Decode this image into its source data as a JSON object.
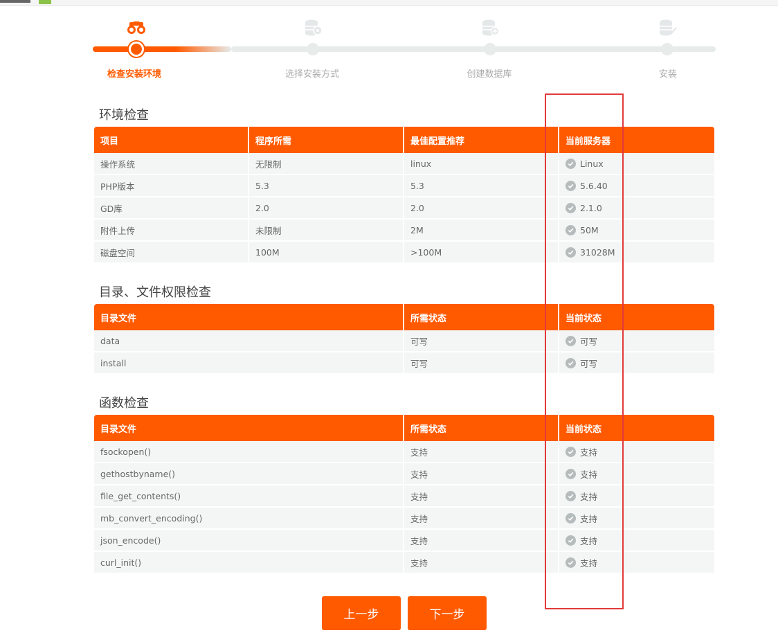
{
  "steps": [
    {
      "label": "检查安装环境",
      "icon": "binoculars-icon",
      "active": true
    },
    {
      "label": "选择安装方式",
      "icon": "database-settings-icon",
      "active": false
    },
    {
      "label": "创建数据库",
      "icon": "database-add-icon",
      "active": false
    },
    {
      "label": "安装",
      "icon": "database-check-icon",
      "active": false
    }
  ],
  "env_check": {
    "title": "环境检查",
    "headers": [
      "项目",
      "程序所需",
      "最佳配置推荐",
      "当前服务器"
    ],
    "rows": [
      [
        "操作系统",
        "无限制",
        "linux",
        "Linux"
      ],
      [
        "PHP版本",
        "5.3",
        "5.3",
        "5.6.40"
      ],
      [
        "GD库",
        "2.0",
        "2.0",
        "2.1.0"
      ],
      [
        "附件上传",
        "未限制",
        "2M",
        "50M"
      ],
      [
        "磁盘空间",
        "100M",
        ">100M",
        "31028M"
      ]
    ]
  },
  "dir_check": {
    "title": "目录、文件权限检查",
    "headers": [
      "目录文件",
      "所需状态",
      "当前状态"
    ],
    "rows": [
      [
        "data",
        "可写",
        "可写"
      ],
      [
        "install",
        "可写",
        "可写"
      ]
    ]
  },
  "func_check": {
    "title": "函数检查",
    "headers": [
      "目录文件",
      "所需状态",
      "当前状态"
    ],
    "rows": [
      [
        "fsockopen()",
        "支持",
        "支持"
      ],
      [
        "gethostbyname()",
        "支持",
        "支持"
      ],
      [
        "file_get_contents()",
        "支持",
        "支持"
      ],
      [
        "mb_convert_encoding()",
        "支持",
        "支持"
      ],
      [
        "json_encode()",
        "支持",
        "支持"
      ],
      [
        "curl_init()",
        "支持",
        "支持"
      ]
    ]
  },
  "buttons": {
    "prev": "上一步",
    "next": "下一步"
  },
  "colors": {
    "accent": "#ff5a00",
    "highlight": "#e23a3a",
    "ok": "#b6bcbc"
  }
}
